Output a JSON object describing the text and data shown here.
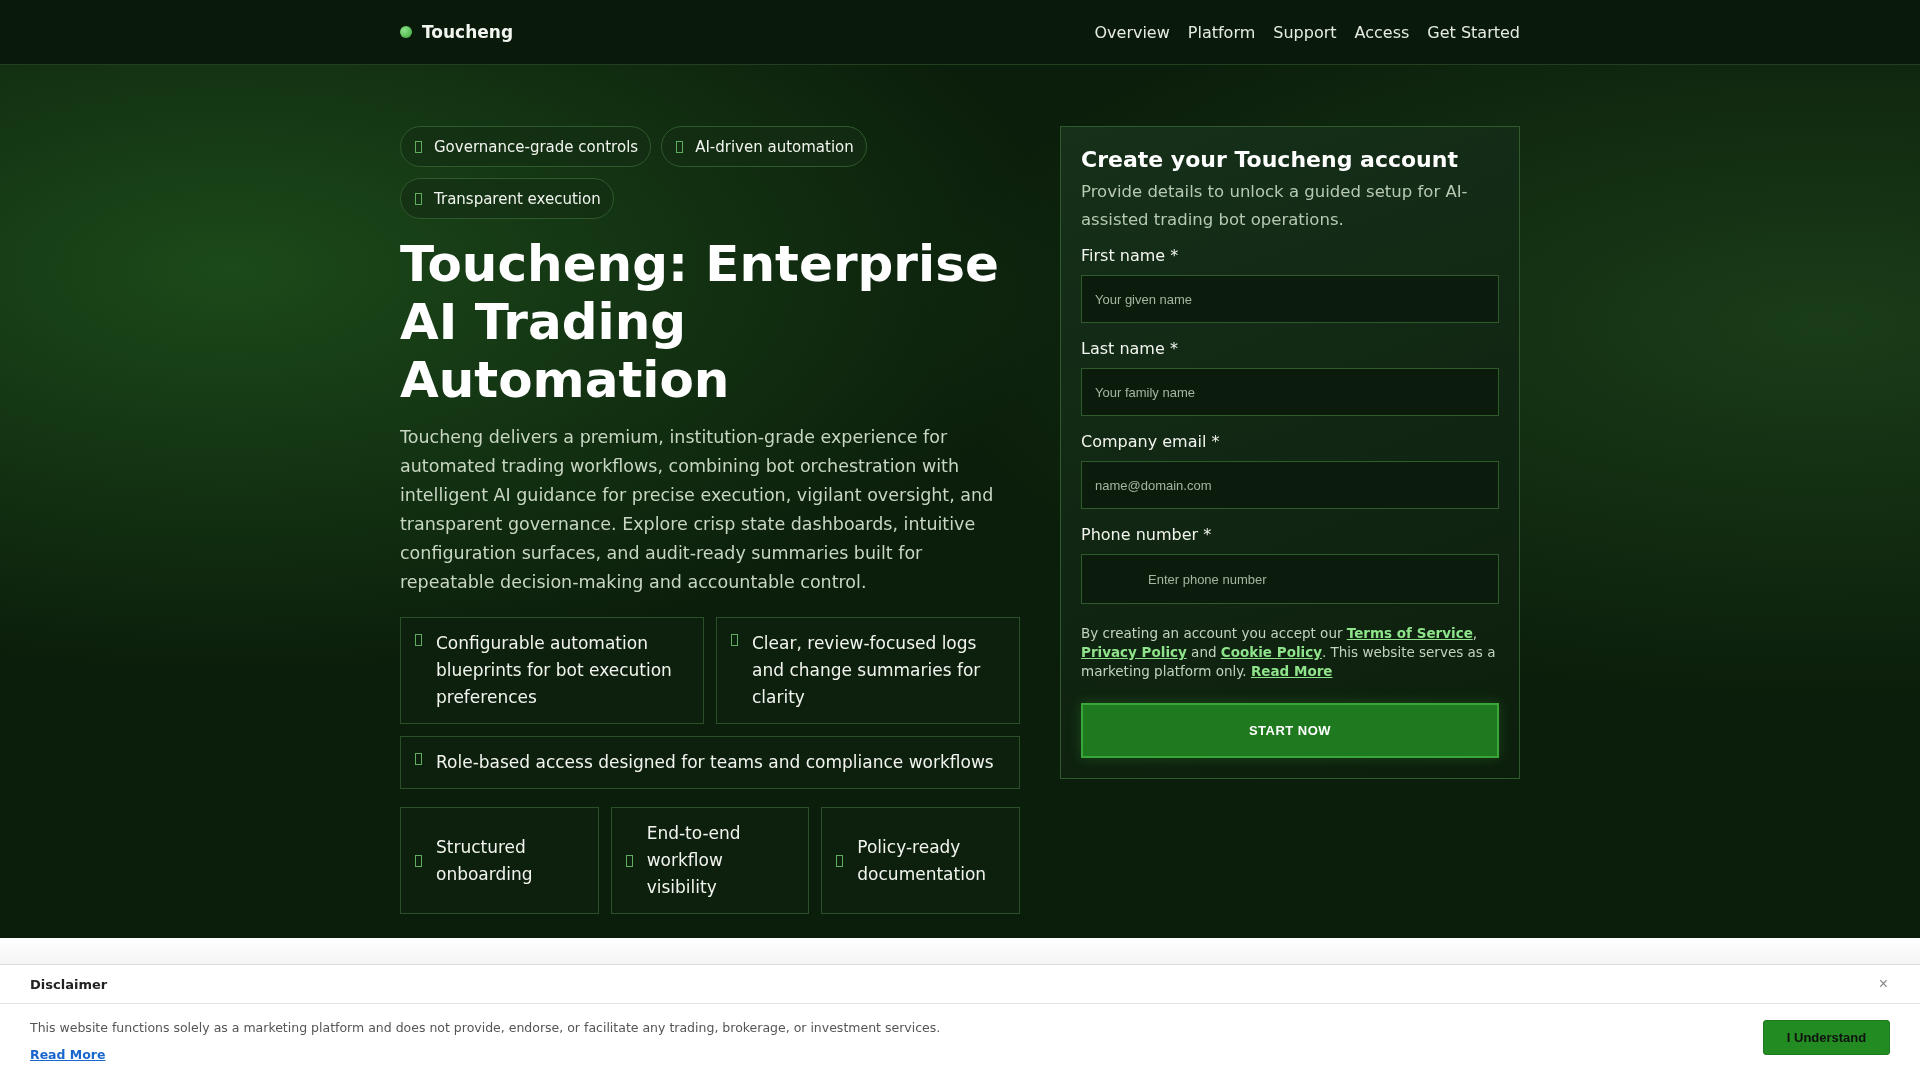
{
  "header": {
    "brand": "Toucheng",
    "nav": [
      "Overview",
      "Platform",
      "Support",
      "Access",
      "Get Started"
    ]
  },
  "hero": {
    "badges": [
      "Governance-grade controls",
      "AI-driven automation",
      "Transparent execution"
    ],
    "title": "Toucheng: Enterprise AI Trading Automation",
    "description": "Toucheng delivers a premium, institution-grade experience for automated trading workflows, combining bot orchestration with intelligent AI guidance for precise execution, vigilant oversight, and transparent governance. Explore crisp state dashboards, intuitive configuration surfaces, and audit-ready summaries built for repeatable decision-making and accountable control.",
    "feature_groups": [
      {
        "kind": "wide",
        "items": [
          "Configurable automation blueprints for bot execution preferences",
          "Clear, review-focused logs and change summaries for clarity"
        ]
      },
      {
        "kind": "wide",
        "items": [
          "Role-based access designed for teams and compliance workflows"
        ]
      },
      {
        "kind": "compact",
        "items": [
          "Structured onboarding",
          "End-to-end workflow visibility",
          "Policy-ready documentation"
        ]
      }
    ]
  },
  "signup": {
    "title": "Create your Toucheng account",
    "subtitle": "Provide details to unlock a guided setup for AI-assisted trading bot operations.",
    "fields": [
      {
        "kind": "text",
        "label": "First name *",
        "placeholder": "Your given name"
      },
      {
        "kind": "text",
        "label": "Last name *",
        "placeholder": "Your family name"
      },
      {
        "kind": "text",
        "label": "Company email *",
        "placeholder": "name@domain.com"
      },
      {
        "kind": "phone",
        "label": "Phone number *",
        "placeholder": "Enter phone number"
      }
    ],
    "consent": [
      {
        "kind": "text",
        "text": "By creating an account you accept our "
      },
      {
        "kind": "link",
        "text": "Terms of Service"
      },
      {
        "kind": "text",
        "text": ", "
      },
      {
        "kind": "link",
        "text": "Privacy Policy"
      },
      {
        "kind": "text",
        "text": " and "
      },
      {
        "kind": "link",
        "text": "Cookie Policy"
      },
      {
        "kind": "text",
        "text": ". This website serves as a marketing platform only. "
      },
      {
        "kind": "link",
        "text": "Read More"
      }
    ],
    "button": "START NOW"
  },
  "disclaimer": {
    "title": "Disclaimer",
    "close": "×",
    "text": "This website functions solely as a marketing platform and does not provide, endorse, or facilitate any trading, brokerage, or investment services.",
    "link": "Read More",
    "button": "I Understand"
  }
}
